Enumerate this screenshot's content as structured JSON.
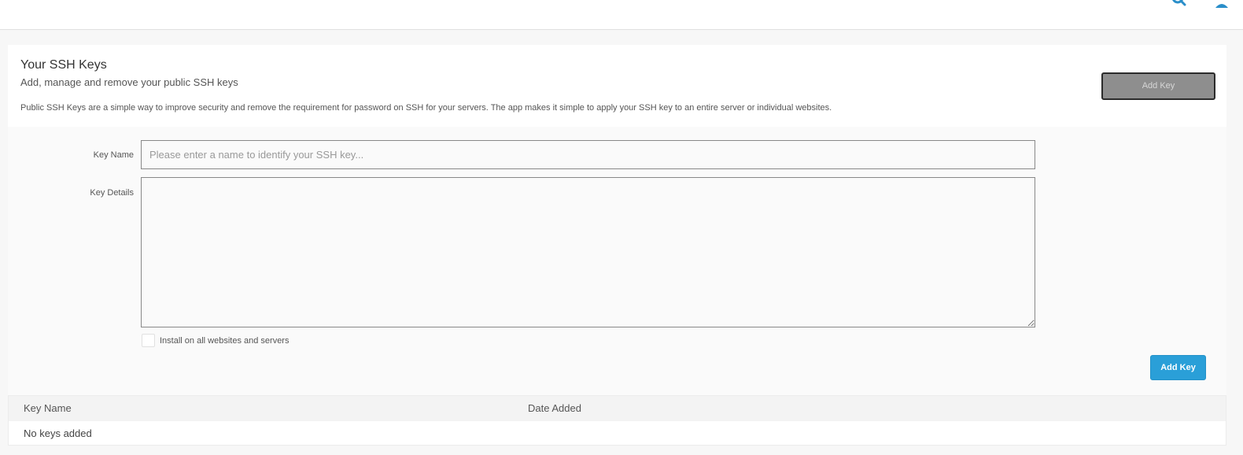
{
  "header": {
    "search_icon": "search-icon",
    "user_icon": "user-icon",
    "icon_color": "#2a8ec9"
  },
  "panel": {
    "title": "Your SSH Keys",
    "subtitle": "Add, manage and remove your public SSH keys",
    "description": "Public SSH Keys are a simple way to improve security and remove the requirement for password on SSH for your servers. The app makes it simple to apply your SSH key to an entire server or individual websites.",
    "add_key_button": "Add Key"
  },
  "form": {
    "key_name_label": "Key Name",
    "key_name_placeholder": "Please enter a name to identify your SSH key...",
    "key_name_value": "",
    "key_details_label": "Key Details",
    "key_details_value": "",
    "install_all_label": "Install on all websites and servers",
    "install_all_checked": false,
    "submit_button": "Add Key",
    "accent_color": "#2a9fd8"
  },
  "table": {
    "columns": [
      "Key Name",
      "Date Added"
    ],
    "rows": [],
    "empty_message": "No keys added"
  }
}
